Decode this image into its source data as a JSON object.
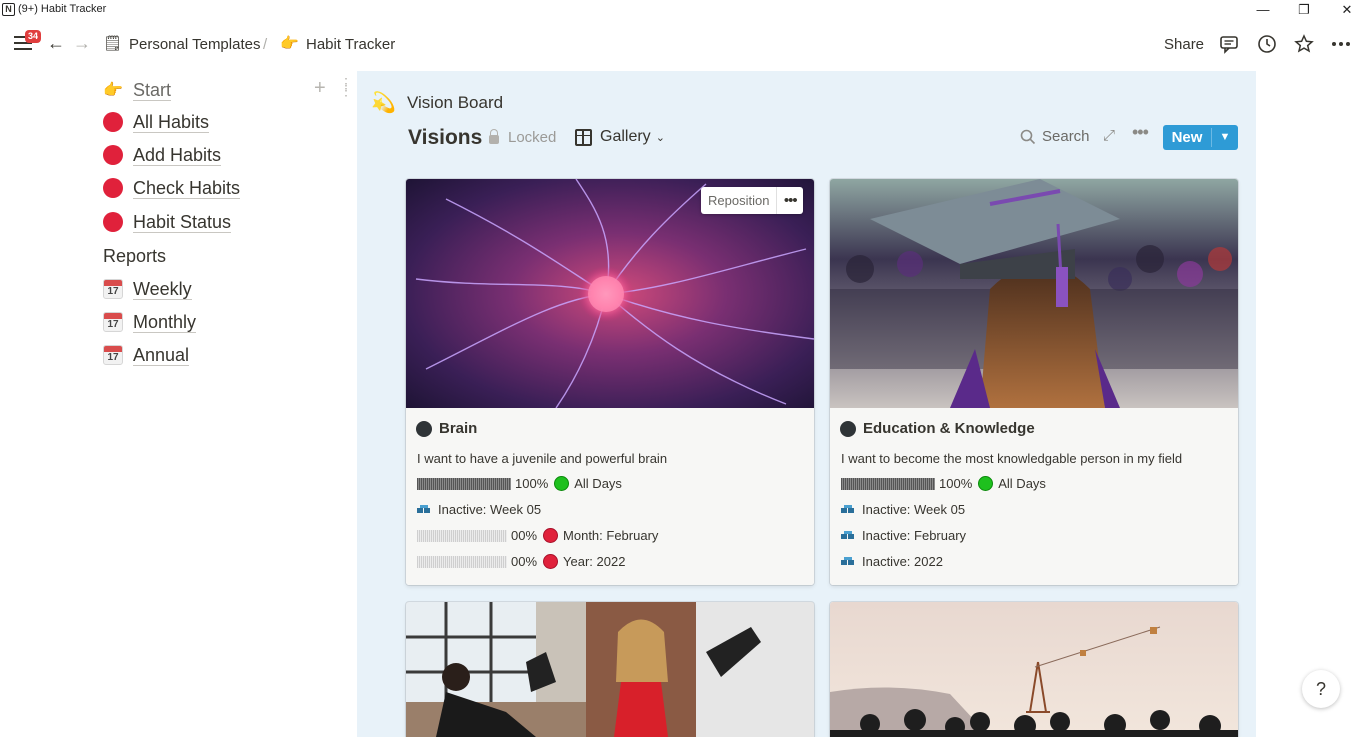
{
  "window": {
    "logo": "N",
    "title": "(9+) Habit Tracker",
    "minimize": "—",
    "restore": "❐",
    "close": "✕"
  },
  "toolbar": {
    "notification_count": "34",
    "back_glyph": "←",
    "forward_glyph": "→",
    "breadcrumb": [
      {
        "icon": "notepad-icon",
        "glyph": "🗒",
        "label": "Personal Templates"
      },
      {
        "icon": "pointing-hand-icon",
        "glyph": "👉",
        "label": "Habit Tracker"
      }
    ],
    "separator": "/",
    "share_label": "Share"
  },
  "sidebar": {
    "items": [
      {
        "label": "Start",
        "icon": "pointing-hand-icon",
        "glyph": "👉"
      },
      {
        "label": "All Habits",
        "icon": "red-circle-icon"
      },
      {
        "label": "Add Habits",
        "icon": "red-circle-icon"
      },
      {
        "label": "Check Habits",
        "icon": "red-circle-icon"
      },
      {
        "label": "Habit Status",
        "icon": "red-circle-icon"
      }
    ],
    "reports_heading": "Reports",
    "reports": [
      {
        "label": "Weekly",
        "icon": "calendar-icon",
        "day": "17"
      },
      {
        "label": "Monthly",
        "icon": "calendar-icon",
        "day": "17"
      },
      {
        "label": "Annual",
        "icon": "calendar-icon",
        "day": "17"
      }
    ]
  },
  "board": {
    "icon_glyph": "💫",
    "title": "Vision Board",
    "view_title": "Visions",
    "locked_label": "Locked",
    "view_type": "Gallery",
    "search_label": "Search",
    "new_label": "New",
    "reposition_label": "Reposition",
    "more_glyph": "•••"
  },
  "cards": [
    {
      "title": "Brain",
      "description": "I want to have a juvenile and powerful brain",
      "rows": [
        {
          "type": "progress",
          "value": 1.0,
          "percent": "100%",
          "status": "green",
          "label": "All Days"
        },
        {
          "type": "inactive",
          "label": "Inactive: Week 05"
        },
        {
          "type": "progress",
          "value": 0,
          "percent": "00%",
          "status": "red",
          "label": "Month: February"
        },
        {
          "type": "progress",
          "value": 0,
          "percent": "00%",
          "status": "red",
          "label": "Year: 2022"
        }
      ]
    },
    {
      "title": "Education & Knowledge",
      "description": "I want to become the most knowledgable person in my field",
      "rows": [
        {
          "type": "progress",
          "value": 1.0,
          "percent": "100%",
          "status": "green",
          "label": "All Days"
        },
        {
          "type": "inactive",
          "label": "Inactive: Week 05"
        },
        {
          "type": "inactive",
          "label": "Inactive: February"
        },
        {
          "type": "inactive",
          "label": "Inactive: 2022"
        }
      ]
    }
  ],
  "colors": {
    "accent": "#2e9bd6",
    "board_bg": "#e8f2f9",
    "habit_red": "#e0213b",
    "status_green": "#1ec01e"
  },
  "help_label": "?"
}
